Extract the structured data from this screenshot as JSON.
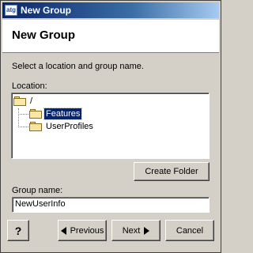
{
  "window": {
    "title": "New Group",
    "app_icon_text": "atg"
  },
  "header": {
    "title": "New Group"
  },
  "instructions": "Select a location and group name.",
  "location": {
    "label": "Location:",
    "tree": [
      {
        "label": "/",
        "icon": "folder-open-icon",
        "selected": false
      },
      {
        "label": "Features",
        "icon": "folder-open-icon",
        "selected": true
      },
      {
        "label": "UserProfiles",
        "icon": "folder-icon",
        "selected": false
      }
    ]
  },
  "buttons": {
    "create_folder": "Create Folder",
    "help": "?",
    "previous": "Previous",
    "next": "Next",
    "cancel": "Cancel"
  },
  "group_name": {
    "label": "Group name:",
    "value": "NewUserInfo"
  },
  "colors": {
    "titlebar": "#0a246a",
    "selection": "#0a246a",
    "face": "#d4d0c8"
  }
}
